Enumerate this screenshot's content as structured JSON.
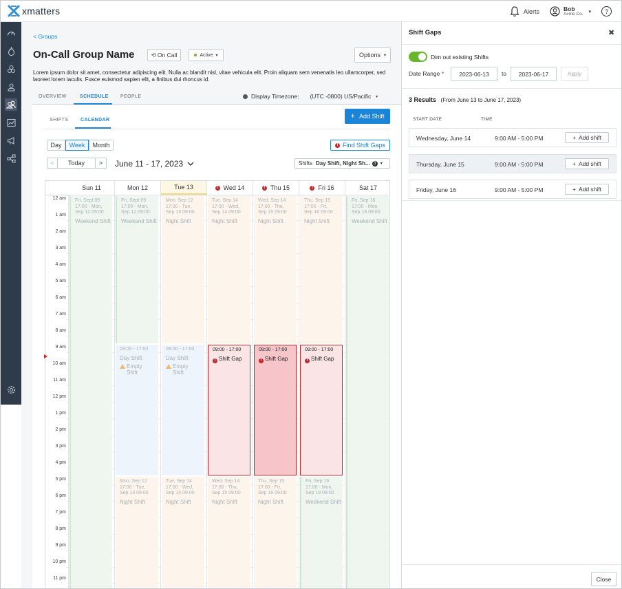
{
  "app": {
    "name": "xmatters"
  },
  "topbar": {
    "alerts_label": "Alerts",
    "user_name": "Bob",
    "user_org": "Acme Co.",
    "help_label": "?"
  },
  "breadcrumb": {
    "label": "< Groups"
  },
  "group": {
    "title": "On-Call Group Name",
    "oncall_label": "On Call",
    "status_label": "Active",
    "options_label": "Options",
    "description": "Lorem ipsum dolor sit amet, consectetur adipiscing elit. Nulla ac blandit nisl, vitae vehicula elit. Proin aliquam sem venenatis leo ullamcorper, sed laoreet lorem iaculis. Fusce euismod sapien elit, a finibus dui rhoncus id."
  },
  "tabs": [
    {
      "label": "OVERVIEW"
    },
    {
      "label": "SCHEDULE"
    },
    {
      "label": "PEOPLE"
    }
  ],
  "timezone": {
    "label": "Display Timezone:",
    "value": "(UTC -0800) US/Pacific"
  },
  "subtabs": [
    {
      "label": "SHIFTS"
    },
    {
      "label": "CALENDAR"
    }
  ],
  "add_shift_label": "Add Shift",
  "view_buttons": [
    {
      "label": "Day"
    },
    {
      "label": "Week"
    },
    {
      "label": "Month"
    }
  ],
  "find_gaps_label": "Find Shift Gaps",
  "nav": {
    "prev": "<",
    "today": "Today",
    "next": ">",
    "range": "June 11 - 17, 2023"
  },
  "shift_filter": {
    "label": "Shifts",
    "value": "Day Shift, Night Sh...",
    "count": "3"
  },
  "calendar": {
    "days": [
      {
        "label": "Sun 11",
        "gap": false
      },
      {
        "label": "Mon 12",
        "gap": false
      },
      {
        "label": "Tue 13",
        "gap": false
      },
      {
        "label": "Wed 14",
        "gap": true
      },
      {
        "label": "Thu 15",
        "gap": true
      },
      {
        "label": "Fri 16",
        "gap": true
      },
      {
        "label": "Sat 17",
        "gap": false
      }
    ],
    "hours": [
      "12 am",
      "1 am",
      "2 am",
      "3 am",
      "4 am",
      "5 am",
      "6 am",
      "7 am",
      "8 am",
      "9 am",
      "10 am",
      "11 am",
      "12 pm",
      "1 pm",
      "2 pm",
      "3 pm",
      "4 pm",
      "5 pm",
      "6 pm",
      "7 pm",
      "8 pm",
      "9 pm",
      "10 pm",
      "11 pm"
    ],
    "events": [
      {
        "day": 0,
        "start": 0,
        "end": 24,
        "kind": "weekend",
        "lines": [
          "Fri, Sept 09",
          "17:00 - Mon,",
          "Sep 12 09:00"
        ],
        "title": "Weekend Shift"
      },
      {
        "day": 1,
        "start": 0,
        "end": 9,
        "kind": "weekend",
        "lines": [
          "Fri, Sept 09",
          "17:00 - Mon,",
          "Sep 12 09:00"
        ],
        "title": "Weekend Shift"
      },
      {
        "day": 1,
        "start": 9,
        "end": 17,
        "kind": "day",
        "lines": [
          "09:00 - 17:00"
        ],
        "title": "Day Shift",
        "warn": "Empty Shift"
      },
      {
        "day": 1,
        "start": 17,
        "end": 24,
        "kind": "night",
        "lines": [
          "Mon, Sep 12",
          "17:00 - Tue,",
          "Sep 13 09:00"
        ],
        "title": "Night Shift"
      },
      {
        "day": 2,
        "start": 0,
        "end": 9,
        "kind": "night",
        "lines": [
          "Mon, Sep 12",
          "17:00 - Tue,",
          "Sep 13 09:00"
        ],
        "title": "Night Shift"
      },
      {
        "day": 2,
        "start": 9,
        "end": 17,
        "kind": "day",
        "lines": [
          "09:00 - 17:00"
        ],
        "title": "Day Shift",
        "warn": "Empty Shift"
      },
      {
        "day": 2,
        "start": 17,
        "end": 24,
        "kind": "night",
        "lines": [
          "Tue, Sep 14",
          "17:00 - Wed,",
          "Sep 14 09:00"
        ],
        "title": "Night Shift"
      },
      {
        "day": 3,
        "start": 0,
        "end": 9,
        "kind": "night",
        "lines": [
          "Tue, Sep 14",
          "17:00 - Wed,",
          "Sep 14 09:00"
        ],
        "title": "Night Shift"
      },
      {
        "day": 3,
        "start": 9,
        "end": 17,
        "kind": "gap",
        "lines": [
          "09:00 - 17:00"
        ],
        "title": "Shift Gap"
      },
      {
        "day": 3,
        "start": 17,
        "end": 24,
        "kind": "night",
        "lines": [
          "Wed, Sep 14",
          "17:00 - Thu,",
          "Sep 15 09:00"
        ],
        "title": "Night Shift"
      },
      {
        "day": 4,
        "start": 0,
        "end": 9,
        "kind": "night",
        "lines": [
          "Wed, Sep 14",
          "17:00 - Thu,",
          "Sep 15 09:00"
        ],
        "title": "Night Shift"
      },
      {
        "day": 4,
        "start": 9,
        "end": 17,
        "kind": "gap-strong",
        "lines": [
          "09:00 - 17:00"
        ],
        "title": "Shift Gap"
      },
      {
        "day": 4,
        "start": 17,
        "end": 24,
        "kind": "night",
        "lines": [
          "Thu, Sep 15",
          "17:00 - Fri,",
          "Sep 16 09:00"
        ],
        "title": "Night Shift"
      },
      {
        "day": 5,
        "start": 0,
        "end": 9,
        "kind": "night",
        "lines": [
          "Thu, Sep 15",
          "17:00 - Fri,",
          "Sep 16 09:00"
        ],
        "title": "Night Shift"
      },
      {
        "day": 5,
        "start": 9,
        "end": 17,
        "kind": "gap",
        "lines": [
          "09:00 - 17:00"
        ],
        "title": "Shift Gap"
      },
      {
        "day": 5,
        "start": 17,
        "end": 24,
        "kind": "weekend",
        "lines": [
          "Fri, Sep 16",
          "17:00 - Mon,",
          "Sep 19 09:00"
        ],
        "title": "Weekend Shift"
      },
      {
        "day": 6,
        "start": 0,
        "end": 24,
        "kind": "weekend",
        "lines": [
          "Fri, Sep 16",
          "17:00 - Mon,",
          "Sep 19 09:00"
        ],
        "title": "Weekend Shift"
      }
    ]
  },
  "panel": {
    "title": "Shift Gaps",
    "dim_label": "Dim out existing Shifts",
    "date_range_label": "Date Range",
    "start_date": "2023-06-13",
    "to_label": "to",
    "end_date": "2023-06-17",
    "apply_label": "Apply",
    "results_count": "3 Results",
    "results_range": "(From June 13 to June 17, 2023)",
    "columns": [
      "START DATE",
      "TIME"
    ],
    "rows": [
      {
        "date": "Wednesday, June 14",
        "time": "9:00 AM - 5:00 PM",
        "action": "Add shift"
      },
      {
        "date": "Thursday, June 15",
        "time": "9:00 AM - 5:00 PM",
        "action": "Add shift"
      },
      {
        "date": "Friday, June 16",
        "time": "9:00 AM - 5:00 PM",
        "action": "Add shift"
      }
    ],
    "close_label": "Close"
  },
  "colors": {
    "accent": "#1a84d8",
    "gap_fill": "#fbe4e6",
    "gap_strong": "#f5c5ca",
    "gap_border": "#c62828",
    "weekend_fill": "#eef6ef",
    "night_fill": "#fdf5ec",
    "day_fill": "#eef4fb",
    "toggle": "#6ab52e"
  }
}
